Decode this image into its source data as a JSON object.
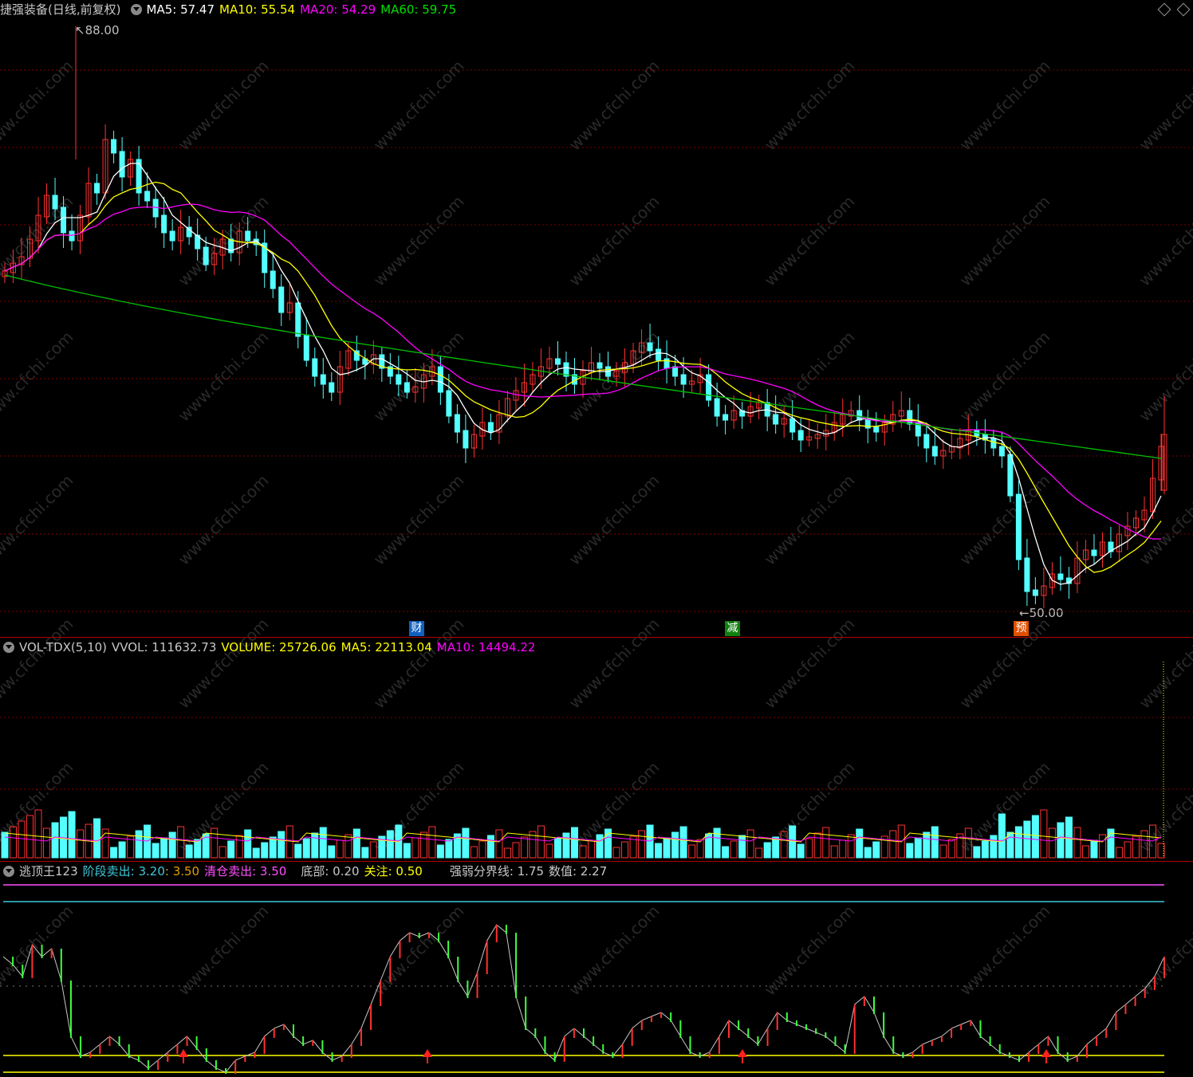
{
  "main": {
    "stock_name": "捷强装备",
    "period": "(日线,前复权)",
    "ma5_label": "MA5: 57.47",
    "ma10_label": "MA10: 55.54",
    "ma20_label": "MA20: 54.29",
    "ma60_label": "MA60: 59.75",
    "high_label": "88.00",
    "low_label": "50.00",
    "colors": {
      "ma5": "#ffffff",
      "ma10": "#ffff00",
      "ma20": "#ff00ff",
      "ma60": "#00c000",
      "up": "#ff3232",
      "down": "#54ffff"
    }
  },
  "badges": [
    {
      "text": "财",
      "color": "#0050c8"
    },
    {
      "text": "减",
      "color": "#008000"
    },
    {
      "text": "预",
      "color": "#e05000"
    }
  ],
  "volume": {
    "name": "VOL-TDX(5,10)",
    "vvol": "VVOL: 111632.73",
    "volume": "VOLUME: 25726.06",
    "ma5": "MA5: 22113.04",
    "ma10": "MA10: 14494.22"
  },
  "indicator": {
    "name": "逃顶王123",
    "stage_sell": "阶段卖出: 3.20",
    "stage_sell_b": ": 3.50",
    "clear_sell": "清仓卖出: 3.50",
    "bottom": "底部: 0.20",
    "watch": "关注: 0.50",
    "divide": "强弱分界线: 1.75",
    "value": "数值: 2.27"
  },
  "watermark": "www.cfchi.com"
}
